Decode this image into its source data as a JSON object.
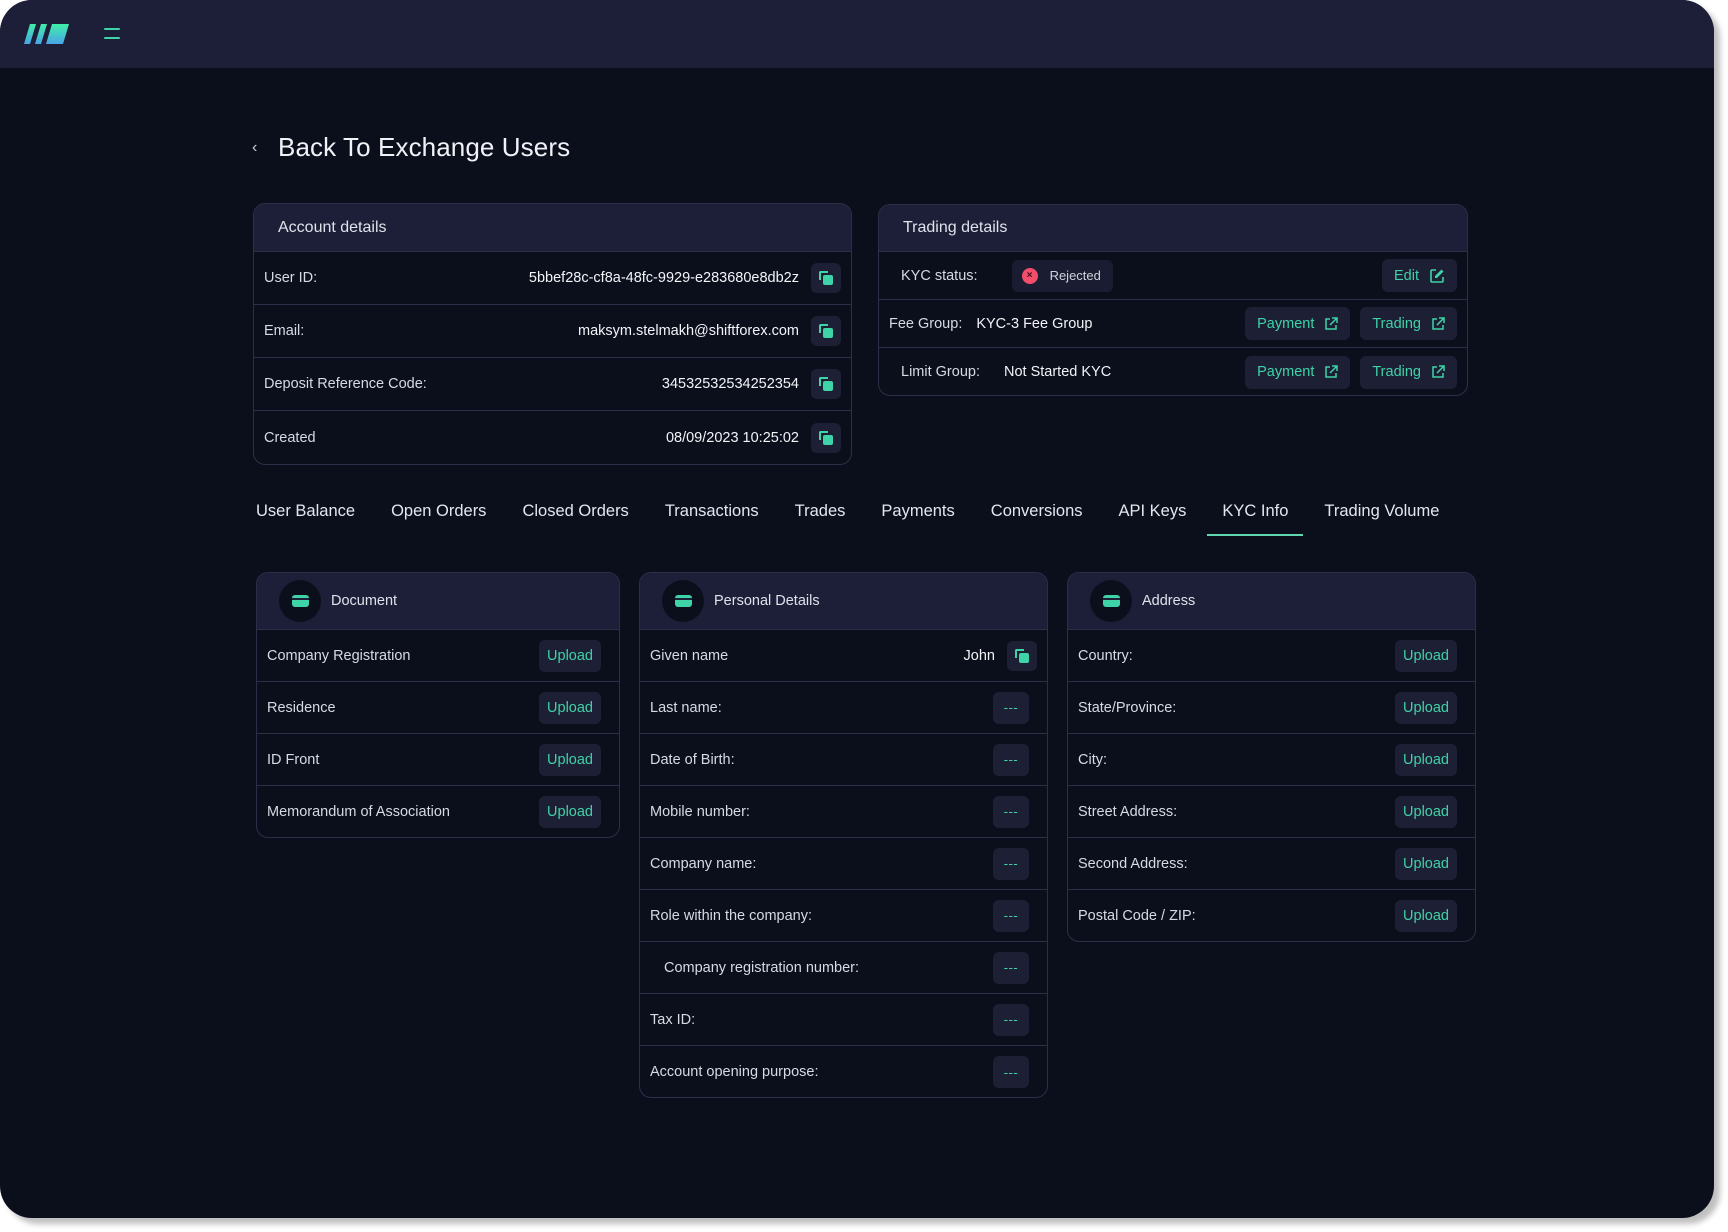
{
  "header": {
    "logo": "brand-logo",
    "menu_icon": "hamburger-menu-icon"
  },
  "back": {
    "label": "Back To Exchange Users"
  },
  "account": {
    "title": "Account details",
    "rows": [
      {
        "label": "User ID:",
        "value": "5bbef28c-cf8a-48fc-9929-e283680e8db2z"
      },
      {
        "label": "Email:",
        "value": "maksym.stelmakh@shiftforex.com"
      },
      {
        "label": "Deposit Reference Code:",
        "value": "34532532534252354"
      },
      {
        "label": "Created",
        "value": "08/09/2023 10:25:02"
      }
    ]
  },
  "trading": {
    "title": "Trading details",
    "kyc_label": "KYC status:",
    "kyc_status": "Rejected",
    "edit_label": "Edit",
    "fee_label": "Fee Group:",
    "fee_value": "KYC-3 Fee Group",
    "limit_label": "Limit Group:",
    "limit_value": "Not Started KYC",
    "payment_label": "Payment",
    "trading_label": "Trading"
  },
  "tabs": [
    {
      "label": "User Balance",
      "active": false
    },
    {
      "label": "Open Orders",
      "active": false
    },
    {
      "label": "Closed Orders",
      "active": false
    },
    {
      "label": "Transactions",
      "active": false
    },
    {
      "label": "Trades",
      "active": false
    },
    {
      "label": "Payments",
      "active": false
    },
    {
      "label": "Conversions",
      "active": false
    },
    {
      "label": "API Keys",
      "active": false
    },
    {
      "label": "KYC Info",
      "active": true
    },
    {
      "label": "Trading Volume",
      "active": false
    }
  ],
  "kyc": {
    "upload_label": "Upload",
    "empty_value": "---",
    "document": {
      "title": "Document",
      "rows": [
        "Company Registration",
        "Residence",
        "ID Front",
        "Memorandum of Association"
      ]
    },
    "personal": {
      "title": "Personal Details",
      "given_label": "Given name",
      "given_value": "John",
      "rows": [
        "Last name:",
        "Date of Birth:",
        "Mobile number:",
        "Company name:",
        "Role within the company:",
        "Company registration number:",
        "Tax ID:",
        "Account opening purpose:"
      ]
    },
    "address": {
      "title": "Address",
      "rows": [
        "Country:",
        "State/Province:",
        "City:",
        "Street Address:",
        "Second Address:",
        "Postal Code / ZIP:"
      ]
    }
  },
  "colors": {
    "accent": "#3fd3a8",
    "background": "#0b0f1c",
    "panel": "#1d1f38",
    "rejected": "#f24e6c"
  }
}
